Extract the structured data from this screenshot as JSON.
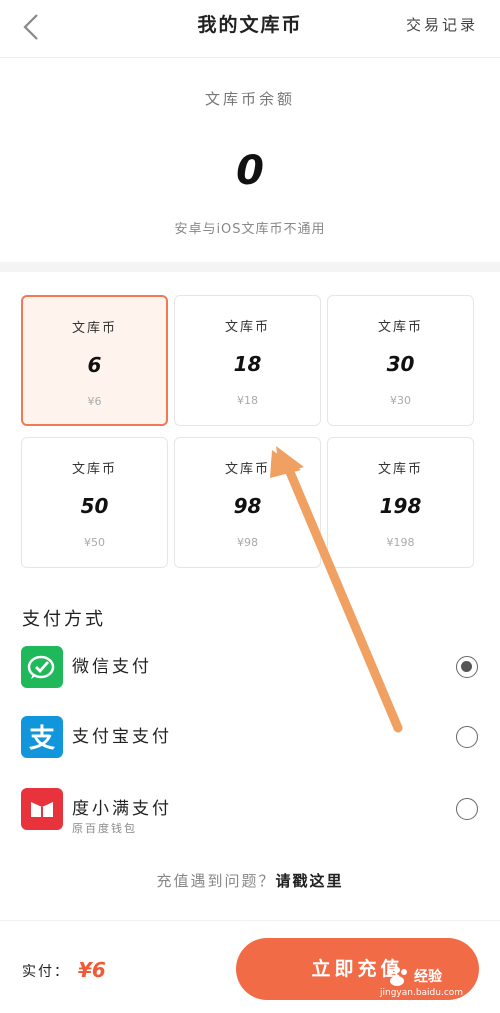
{
  "header": {
    "title": "我的文库币",
    "records_label": "交易记录"
  },
  "balance": {
    "label": "文库币余额",
    "value": "0",
    "note": "安卓与iOS文库币不通用"
  },
  "packages": [
    {
      "name": "文库币",
      "amount": "6",
      "price": "¥6",
      "selected": true
    },
    {
      "name": "文库币",
      "amount": "18",
      "price": "¥18",
      "selected": false
    },
    {
      "name": "文库币",
      "amount": "30",
      "price": "¥30",
      "selected": false
    },
    {
      "name": "文库币",
      "amount": "50",
      "price": "¥50",
      "selected": false
    },
    {
      "name": "文库币",
      "amount": "98",
      "price": "¥98",
      "selected": false
    },
    {
      "name": "文库币",
      "amount": "198",
      "price": "¥198",
      "selected": false
    }
  ],
  "payment": {
    "title": "支付方式",
    "methods": [
      {
        "label": "微信支付",
        "subtext": "",
        "icon": "wechat-pay-icon",
        "color": "#1fb85a",
        "selected": true
      },
      {
        "label": "支付宝支付",
        "subtext": "",
        "icon": "alipay-icon",
        "color": "#1296db",
        "selected": false
      },
      {
        "label": "度小满支付",
        "subtext": "原百度钱包",
        "icon": "duxiaoman-icon",
        "color": "#e8323c",
        "selected": false
      }
    ]
  },
  "help": {
    "question": "充值遇到问题？",
    "link": "请戳这里"
  },
  "footer": {
    "paid_label": "实付：",
    "paid_amount": "¥6",
    "cta_label": "立即充值"
  },
  "watermark": {
    "text": "经验",
    "url": "jingyan.baidu.com"
  },
  "colors": {
    "accent": "#f26b47",
    "selected_border": "#f17a55",
    "annotation_arrow": "#f0a060"
  }
}
